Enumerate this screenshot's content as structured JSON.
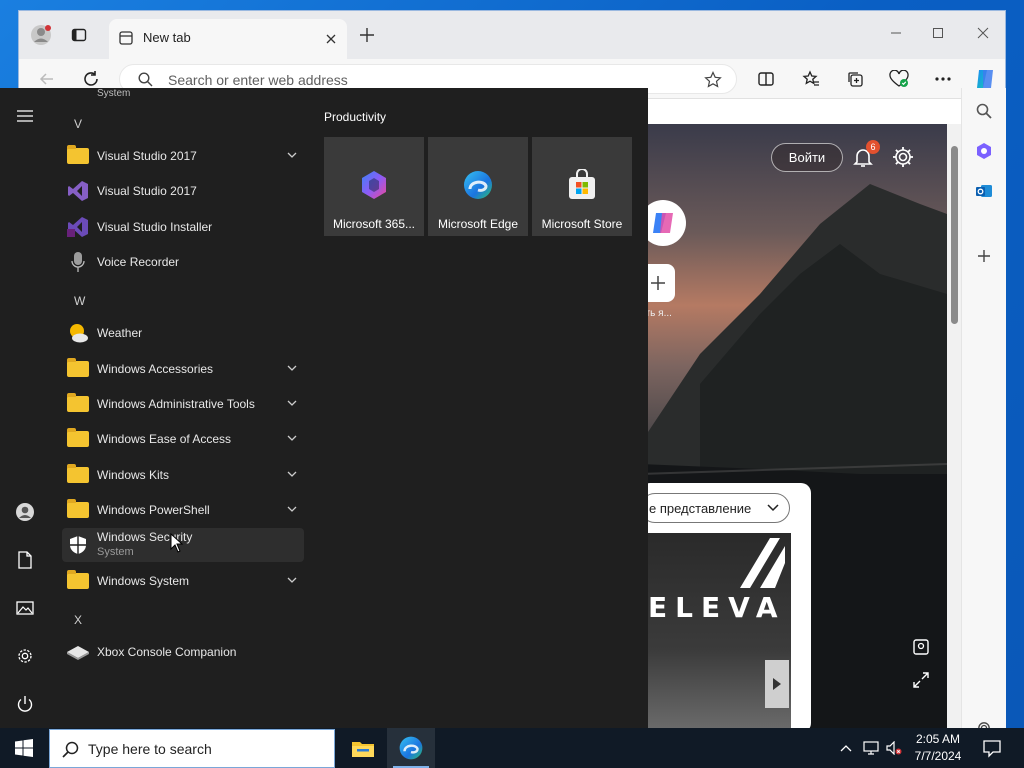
{
  "browser": {
    "tab_title": "New tab",
    "address_placeholder": "Search or enter web address"
  },
  "newtab": {
    "signin_label": "Войти",
    "notification_count": "6",
    "add_shortcut_label": "ить я...",
    "view_selector_label": "е представление",
    "promo_text": "ELEVA"
  },
  "start_menu": {
    "letters": {
      "v": "V",
      "w": "W",
      "x": "X"
    },
    "partial_top_item": "System",
    "apps": [
      {
        "label": "Visual Studio 2017",
        "kind": "folder"
      },
      {
        "label": "Visual Studio 2017",
        "kind": "app"
      },
      {
        "label": "Visual Studio Installer",
        "kind": "app"
      },
      {
        "label": "Voice Recorder",
        "kind": "app"
      },
      {
        "label": "Weather",
        "kind": "app"
      },
      {
        "label": "Windows Accessories",
        "kind": "folder"
      },
      {
        "label": "Windows Administrative Tools",
        "kind": "folder"
      },
      {
        "label": "Windows Ease of Access",
        "kind": "folder"
      },
      {
        "label": "Windows Kits",
        "kind": "folder"
      },
      {
        "label": "Windows PowerShell",
        "kind": "folder"
      },
      {
        "label": "Windows Security",
        "sublabel": "System",
        "kind": "app"
      },
      {
        "label": "Windows System",
        "kind": "folder"
      },
      {
        "label": "Xbox Console Companion",
        "kind": "app"
      }
    ],
    "group_title": "Productivity",
    "tiles": [
      {
        "label": "Microsoft 365...",
        "icon": "microsoft-365-icon"
      },
      {
        "label": "Microsoft Edge",
        "icon": "edge-icon"
      },
      {
        "label": "Microsoft Store",
        "icon": "store-icon"
      }
    ]
  },
  "taskbar": {
    "search_placeholder": "Type here to search",
    "time": "2:05 AM",
    "date": "7/7/2024"
  },
  "colors": {
    "accent": "#0a66c8",
    "start_bg": "#1f1f1f",
    "folder": "#f4c430"
  }
}
